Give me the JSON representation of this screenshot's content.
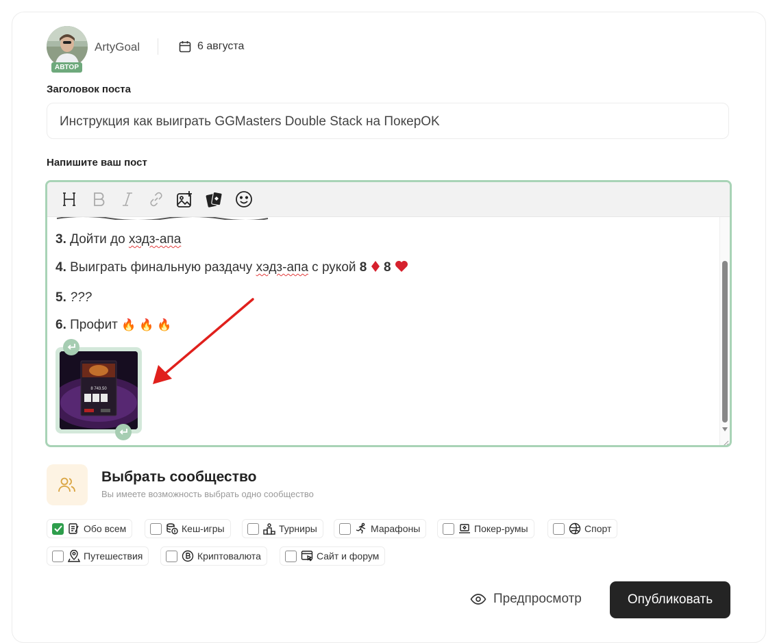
{
  "author": {
    "name": "ArtyGoal",
    "badge": "АВТОР",
    "date": "6 августа"
  },
  "title_field": {
    "label": "Заголовок поста",
    "value": "Инструкция как выиграть GGMasters Double Stack на ПокерOK"
  },
  "editor": {
    "label": "Напишите ваш пост",
    "toolbar": [
      "heading-icon",
      "bold-icon",
      "italic-icon",
      "link-icon",
      "add-image-icon",
      "cards-icon",
      "emoji-icon"
    ],
    "lines": [
      {
        "num": "3.",
        "pre": "Дойти до ",
        "squiggle": "хэдз-апа",
        "post": ""
      },
      {
        "num": "4.",
        "pre": "Выиграть финальную раздачу ",
        "squiggle": "хэдз-апа",
        "post": " с рукой ",
        "cards": "8",
        "cards2": "8"
      },
      {
        "num": "5.",
        "italic": "???"
      },
      {
        "num": "6.",
        "pre": "Профит ",
        "emoji": "🔥 🔥 🔥"
      }
    ],
    "image_amount": "8 743.50"
  },
  "community": {
    "title": "Выбрать сообщество",
    "subtitle": "Вы имеете возможность выбрать одно сообщество",
    "options": [
      {
        "label": "Обо всем",
        "checked": true,
        "icon": "notes-icon"
      },
      {
        "label": "Кеш-игры",
        "checked": false,
        "icon": "coins-icon"
      },
      {
        "label": "Турниры",
        "checked": false,
        "icon": "podium-icon"
      },
      {
        "label": "Марафоны",
        "checked": false,
        "icon": "runner-icon"
      },
      {
        "label": "Покер-румы",
        "checked": false,
        "icon": "laptop-icon"
      },
      {
        "label": "Спорт",
        "checked": false,
        "icon": "ball-icon"
      },
      {
        "label": "Путешествия",
        "checked": false,
        "icon": "map-pin-icon"
      },
      {
        "label": "Криптовалюта",
        "checked": false,
        "icon": "bitcoin-icon"
      },
      {
        "label": "Сайт и форум",
        "checked": false,
        "icon": "browser-icon"
      }
    ]
  },
  "actions": {
    "preview": "Предпросмотр",
    "publish": "Опубликовать"
  },
  "colors": {
    "accent_green": "#a8d3b6",
    "badge_green": "#6ea97c",
    "check_green": "#2e9e4c",
    "publish_bg": "#242424",
    "arrow_red": "#e0201c"
  }
}
